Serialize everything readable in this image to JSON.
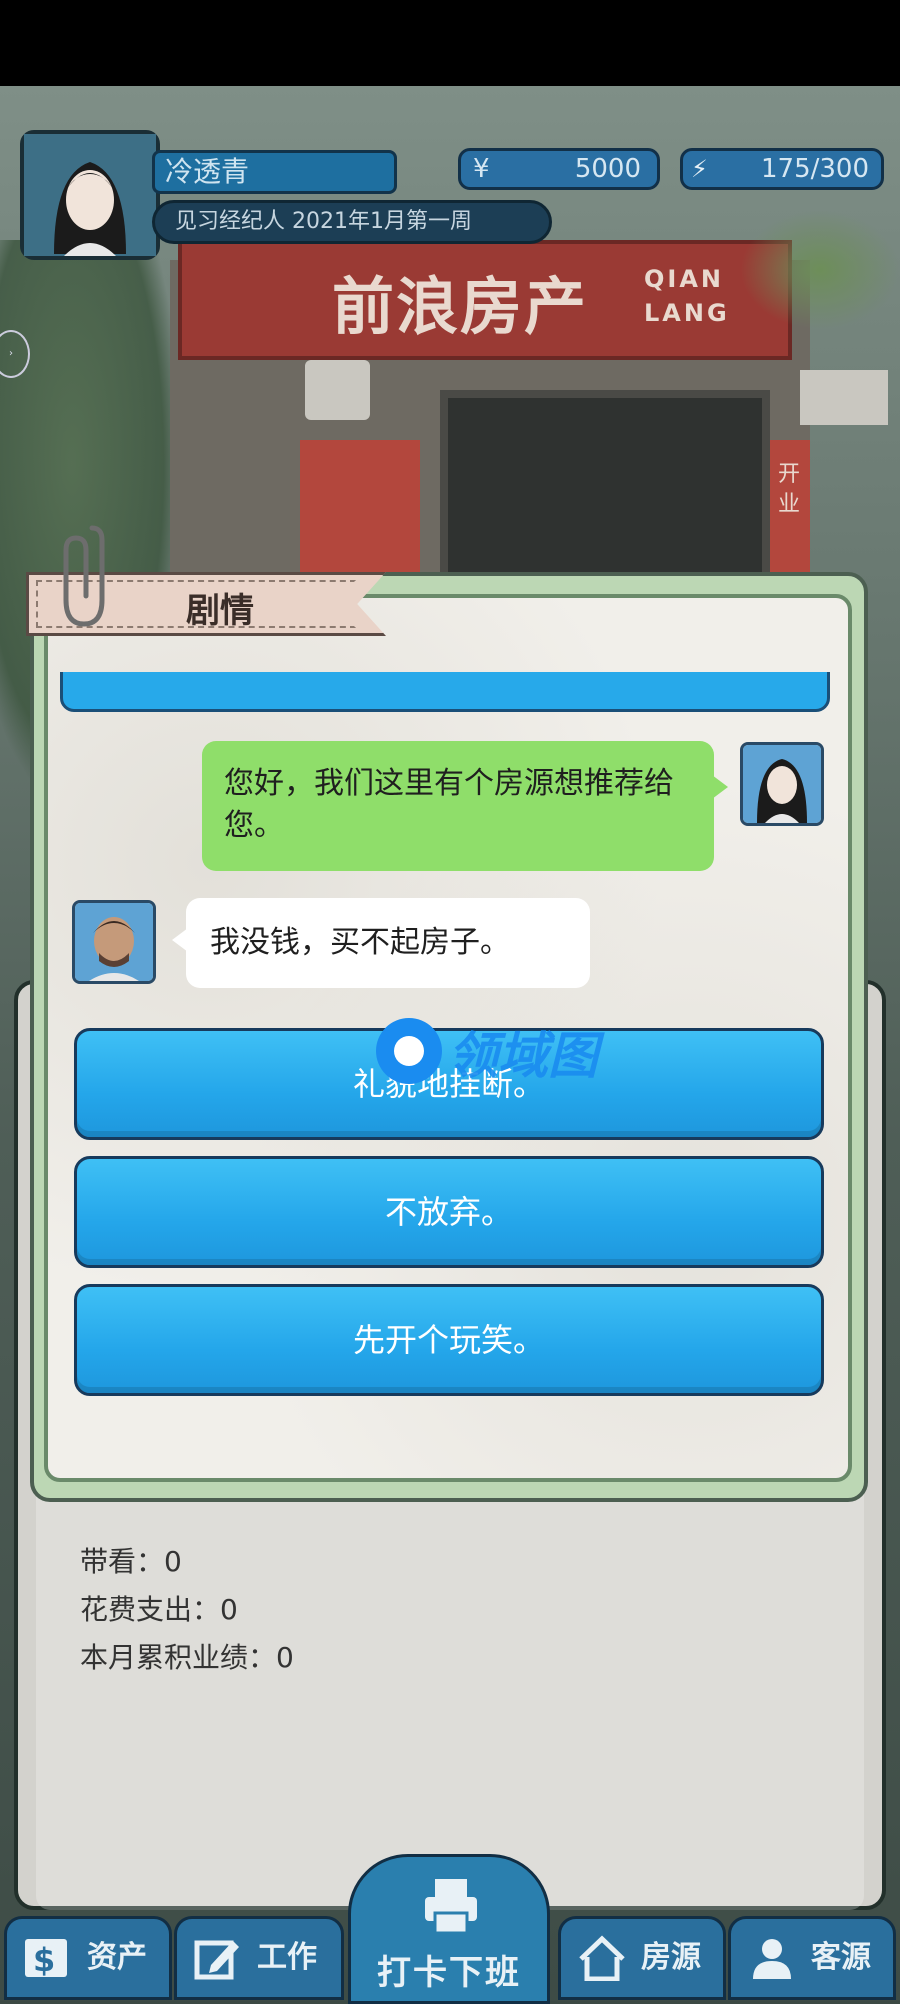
{
  "player": {
    "name": "冷透青",
    "title": "见习经纪人 2021年1月第一周",
    "money_symbol": "¥",
    "money": "5000",
    "energy": "175/300"
  },
  "scene": {
    "shop_name": "前浪房产",
    "shop_name_en_1": "QIAN",
    "shop_name_en_2": "LANG",
    "pillar_text": "开业"
  },
  "dialog": {
    "tab_label": "剧情",
    "messages": [
      {
        "speaker": "player",
        "text": "您好，我们这里有个房源想推荐给您。"
      },
      {
        "speaker": "customer",
        "text": "我没钱，买不起房子。"
      }
    ],
    "choices": [
      "礼貌地挂断。",
      "不放弃。",
      "先开个玩笑。"
    ]
  },
  "watermark": "领域图",
  "stats": {
    "viewings": "带看：0",
    "expenses": "花费支出：0",
    "monthly_performance": "本月累积业绩：0"
  },
  "nav": {
    "assets": "资产",
    "work": "工作",
    "clock_out": "打卡下班",
    "listings": "房源",
    "clients": "客源"
  },
  "colors": {
    "choice_blue": "#27a9ea",
    "bubble_green": "#8fde6a",
    "nav_blue": "#2a6f9d"
  }
}
